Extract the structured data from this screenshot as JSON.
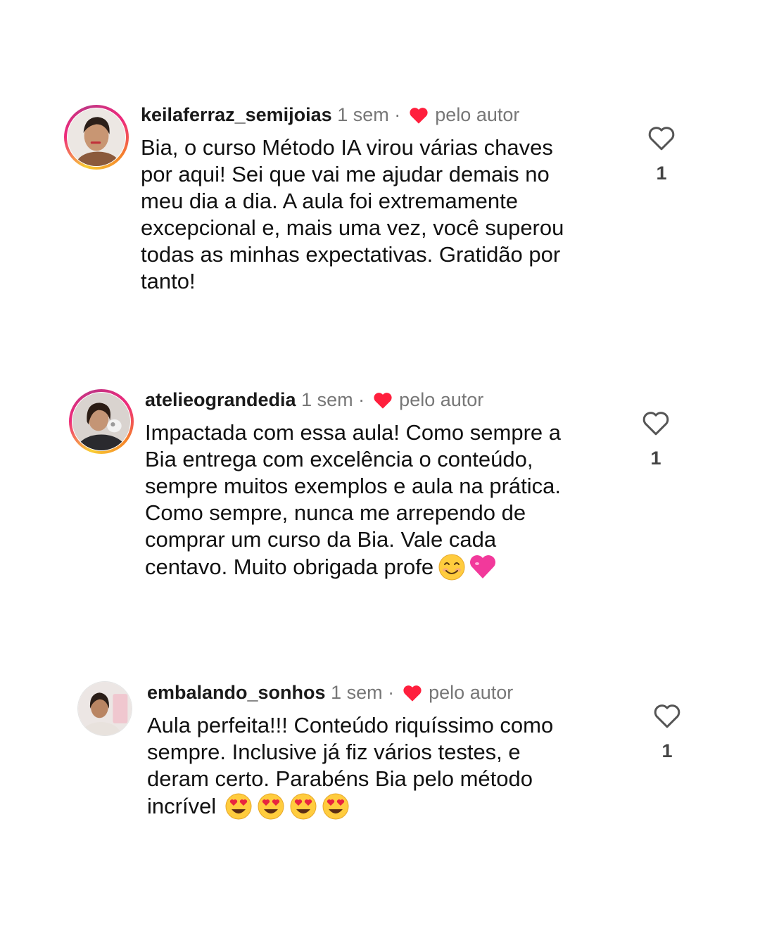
{
  "comments": [
    {
      "username": "keilaferraz_semijoias",
      "time": "1 sem",
      "separator": "·",
      "liked_by_author": "pelo autor",
      "text": "Bia, o curso Método IA virou várias chaves\npor aqui! Sei que vai me ajudar demais no\nmeu dia a dia. A aula foi extremamente\nexcepcional e, mais uma vez, você superou\ntodas as minhas expectativas. Gratidão por\ntanto!",
      "likes": "1",
      "story_ring": true
    },
    {
      "username": "atelieograndedia",
      "time": "1 sem",
      "separator": "·",
      "liked_by_author": "pelo autor",
      "text": "Impactada com essa aula! Como sempre a\nBia entrega com excelência o conteúdo,\nsempre muitos exemplos e aula na prática.\nComo sempre, nunca me arrependo de\ncomprar um curso da Bia. Vale cada\ncentavo. Muito obrigada profe",
      "emojis": [
        "smiling-face-emoji",
        "pink-heart-emoji"
      ],
      "likes": "1",
      "story_ring": true
    },
    {
      "username": "embalando_sonhos",
      "time": "1 sem",
      "separator": "·",
      "liked_by_author": "pelo autor",
      "text": "Aula perfeita!!! Conteúdo riquíssimo como\nsempre. Inclusive já fiz vários testes, e\nderam certo.  Parabéns Bia pelo método\nincrível",
      "emojis": [
        "heart-eyes-emoji",
        "heart-eyes-emoji",
        "heart-eyes-emoji",
        "heart-eyes-emoji"
      ],
      "likes": "1",
      "story_ring": false
    }
  ],
  "colors": {
    "author_heart": "#ff1f3d",
    "muted_text": "#777777",
    "ring_gradient": [
      "#f9ce34",
      "#ee2a7b",
      "#c13584"
    ]
  }
}
